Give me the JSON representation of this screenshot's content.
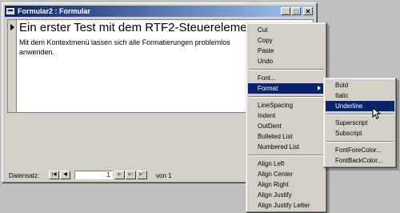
{
  "window": {
    "title": "Formular2 : Formular",
    "minimize_label": "_",
    "maximize_label": "□",
    "close_label": "✕"
  },
  "document": {
    "heading": "Ein erster Test mit dem RTF2-Steuerelement",
    "paragraph": "Mit dem Kontextmenü lassen sich alle Formatierungen problemlos anwenden."
  },
  "record_nav": {
    "label": "Datensatz:",
    "first": "|◀",
    "prev": "◀",
    "current": "1",
    "next": "▶",
    "last": "▶|",
    "new": "▶*",
    "of_label": "von",
    "total": "1"
  },
  "context_menu": {
    "cut": "Cut",
    "copy": "Copy",
    "paste": "Paste",
    "undo": "Undo",
    "font": "Font...",
    "format": "Format",
    "linespacing": "LineSpacing",
    "indent": "Indent",
    "outdent": "OutDent",
    "bulleted": "Bulleted List",
    "numbered": "Numbered List",
    "align_left": "Align Left",
    "align_center": "Align Center",
    "align_right": "Align Right",
    "align_justify": "Align Justify",
    "align_justify_letter": "Align Justify Letter"
  },
  "format_submenu": {
    "bold": "Bold",
    "italic": "Italic",
    "underline": "Underline",
    "superscript": "Superscript",
    "subscript": "Subscript",
    "forecolor": "FontForeColor...",
    "backcolor": "FontBackColor..."
  },
  "colors": {
    "titlebar_start": "#0a246a",
    "titlebar_end": "#a6caf0",
    "highlight": "#0a246a",
    "face": "#d4d0c8"
  }
}
